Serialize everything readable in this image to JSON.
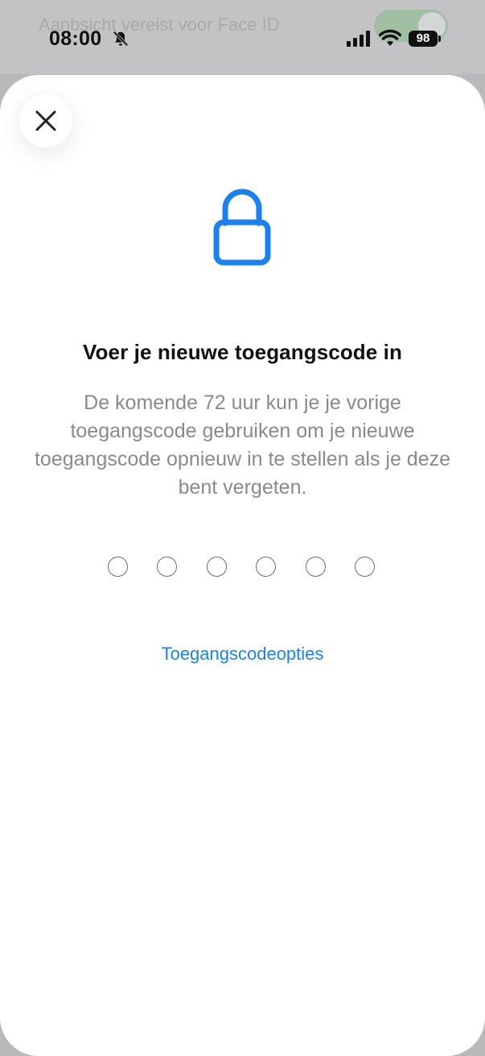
{
  "background": {
    "row_text": "Aanbsicht vereist voor Face ID",
    "toggle_on": true
  },
  "status_bar": {
    "time": "08:00",
    "battery": "98",
    "icons": [
      "bell-slash-icon",
      "cellular-signal-icon",
      "wifi-icon",
      "battery-icon"
    ]
  },
  "sheet": {
    "close_icon": "close-icon",
    "lock_icon": "lock-icon",
    "title": "Voer je nieuwe toegangscode in",
    "description": "De komende 72 uur kun je je vorige toegangscode gebruiken om je nieuwe toegangscode opnieuw in te stellen als je deze bent vergeten.",
    "passcode_length": 6,
    "entered_digits": 0,
    "options_link": "Toegangscodeopties"
  },
  "colors": {
    "accent": "#1a82f0",
    "title": "#111111",
    "secondary_text": "#8a8a8e"
  }
}
